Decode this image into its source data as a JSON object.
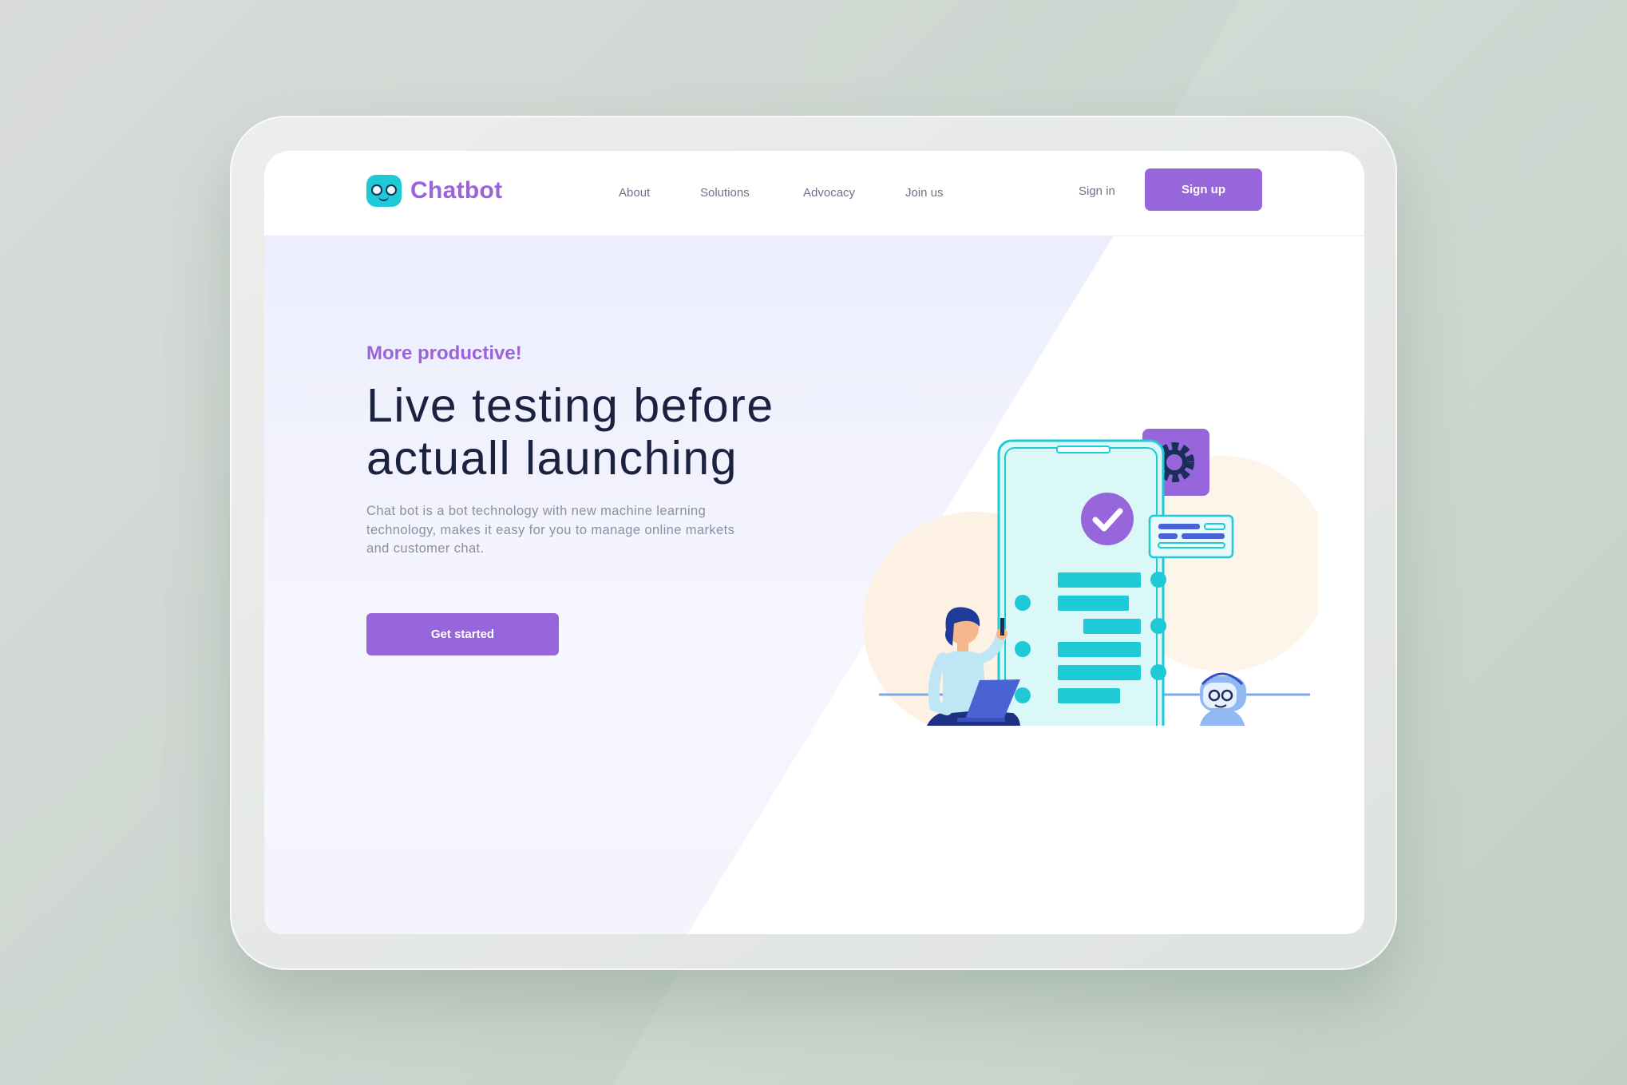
{
  "brand": {
    "name": "Chatbot",
    "logo_icon": "robot-face-icon"
  },
  "nav": {
    "links": [
      "About",
      "Solutions",
      "Advocacy",
      "Join us"
    ],
    "sign_in": "Sign in",
    "sign_up": "Sign up"
  },
  "hero": {
    "tagline": "More productive!",
    "headline_line1": "Live testing before",
    "headline_line2": "actuall launching",
    "description": "Chat bot is a bot technology with new machine learning technology, makes it easy for you to manage online markets and customer chat.",
    "cta": "Get started"
  },
  "colors": {
    "accent_purple": "#9866db",
    "teal": "#1dcad6",
    "navy": "#1b2240",
    "body_text": "#8a8fa3"
  }
}
